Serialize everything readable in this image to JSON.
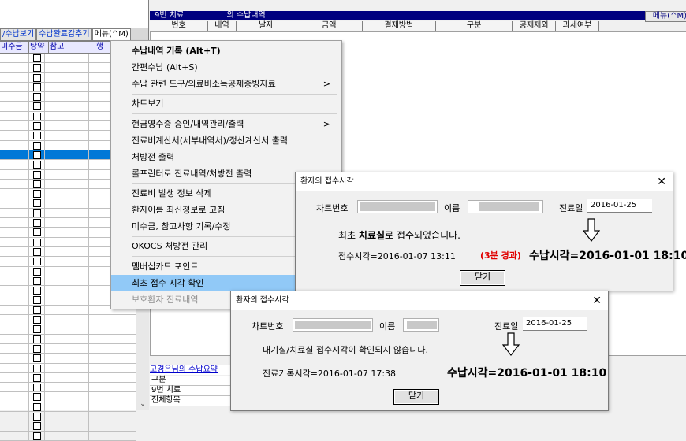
{
  "left_toolbar": {
    "items": [
      "/수납보기",
      "수납완료감추기",
      "메뉴(^M)"
    ]
  },
  "left_header": {
    "cols": [
      "미수금",
      "탕약",
      "참고",
      "행"
    ]
  },
  "top_list": {
    "title_left": "9번 치료",
    "title_right": "의 수납내역",
    "menu_right": "메뉴(^M)",
    "headers": [
      "번호",
      "내역",
      "날자",
      "금액",
      "결제방법",
      "구분",
      "공제제외",
      "과세여부"
    ]
  },
  "summary": {
    "title": "고경은님의 수납요약",
    "rows": [
      "구분",
      "9번 치료",
      "전체항목"
    ]
  },
  "context_menu": {
    "items": [
      {
        "label": "수납내역 기록 (Alt+T)",
        "bold": true
      },
      {
        "label": "간편수납 (Alt+S)"
      },
      {
        "label": "수납 관련 도구/의료비소득공제증빙자료",
        "submenu": ">"
      },
      {
        "label": "차트보기"
      },
      {
        "label": "현금영수증 승인/내역관리/출력",
        "submenu": ">"
      },
      {
        "label": "진료비계산서(세부내역서)/정산계산서 출력"
      },
      {
        "label": "처방전 출력"
      },
      {
        "label": "롤프린터로 진료내역/처방전 출력"
      },
      {
        "label": "진료비 발생 정보 삭제"
      },
      {
        "label": "환자이름 최신정보로 고침"
      },
      {
        "label": "미수금, 참고사항 기록/수정"
      },
      {
        "label": "OKOCS 처방전 관리"
      },
      {
        "label": "멤버십카드 포인트"
      },
      {
        "label": "최초 접수 시각 확인",
        "highlighted": true
      },
      {
        "label": "보호환자 진료내역",
        "disabled": true
      }
    ]
  },
  "dialog1": {
    "title": "환자의 접수시각",
    "close": "✕",
    "chart_no_label": "차트번호",
    "name_label": "이름",
    "visit_date_label": "진료일",
    "visit_date": "2016-01-25",
    "msg_prefix": "최초",
    "msg_bold": "치료실",
    "msg_suffix": "로 접수되었습니다.",
    "reception_time": "접수시각=2016-01-07 13:11",
    "elapsed": "(3분 경과)",
    "payment_time": "수납시각=2016-01-01 18:10",
    "close_btn": "닫기"
  },
  "dialog2": {
    "title": "환자의 접수시각",
    "close": "✕",
    "chart_no_label": "차트번호",
    "name_label": "이름",
    "visit_date_label": "진료일",
    "visit_date": "2016-01-25",
    "message": "대기실/치료실 접수시각이 확인되지 않습니다.",
    "record_time": "진료기록시각=2016-01-07 17:38",
    "payment_time": "수납시각=2016-01-01 18:10",
    "close_btn": "닫기"
  }
}
